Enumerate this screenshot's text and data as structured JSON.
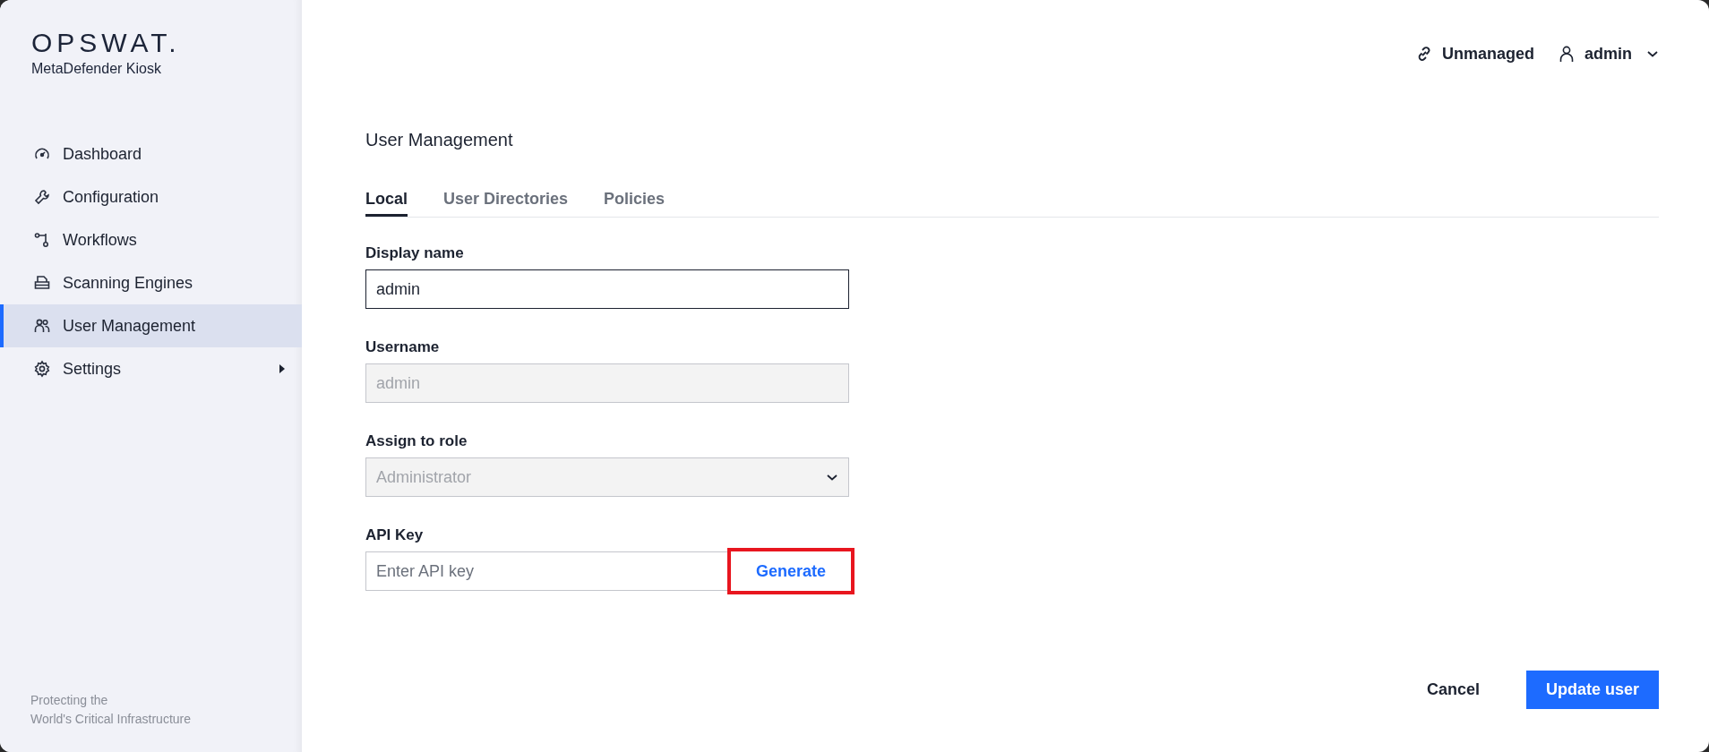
{
  "sidebar": {
    "logo": "OPSWAT.",
    "product": "MetaDefender Kiosk",
    "items": [
      {
        "label": "Dashboard",
        "selected": false,
        "has_submenu": false
      },
      {
        "label": "Configuration",
        "selected": false,
        "has_submenu": false
      },
      {
        "label": "Workflows",
        "selected": false,
        "has_submenu": false
      },
      {
        "label": "Scanning Engines",
        "selected": false,
        "has_submenu": false
      },
      {
        "label": "User Management",
        "selected": true,
        "has_submenu": false
      },
      {
        "label": "Settings",
        "selected": false,
        "has_submenu": true
      }
    ],
    "footer": [
      "Protecting the",
      "World's Critical Infrastructure"
    ]
  },
  "header": {
    "status": "Unmanaged",
    "user": "admin"
  },
  "page_title": "User Management",
  "tabs": [
    {
      "label": "Local",
      "selected": true
    },
    {
      "label": "User Directories",
      "selected": false
    },
    {
      "label": "Policies",
      "selected": false
    }
  ],
  "form": {
    "fields": [
      {
        "kind": "text",
        "label": "Display name",
        "value": "admin",
        "disabled": false
      },
      {
        "kind": "text",
        "label": "Username",
        "value": "admin",
        "disabled": true
      },
      {
        "kind": "select",
        "label": "Assign to role",
        "value": "Administrator",
        "disabled": true
      },
      {
        "kind": "apikey",
        "label": "API Key",
        "placeholder": "Enter API key",
        "button": "Generate",
        "highlighted": true
      }
    ]
  },
  "actions": {
    "cancel": "Cancel",
    "submit": "Update user"
  }
}
